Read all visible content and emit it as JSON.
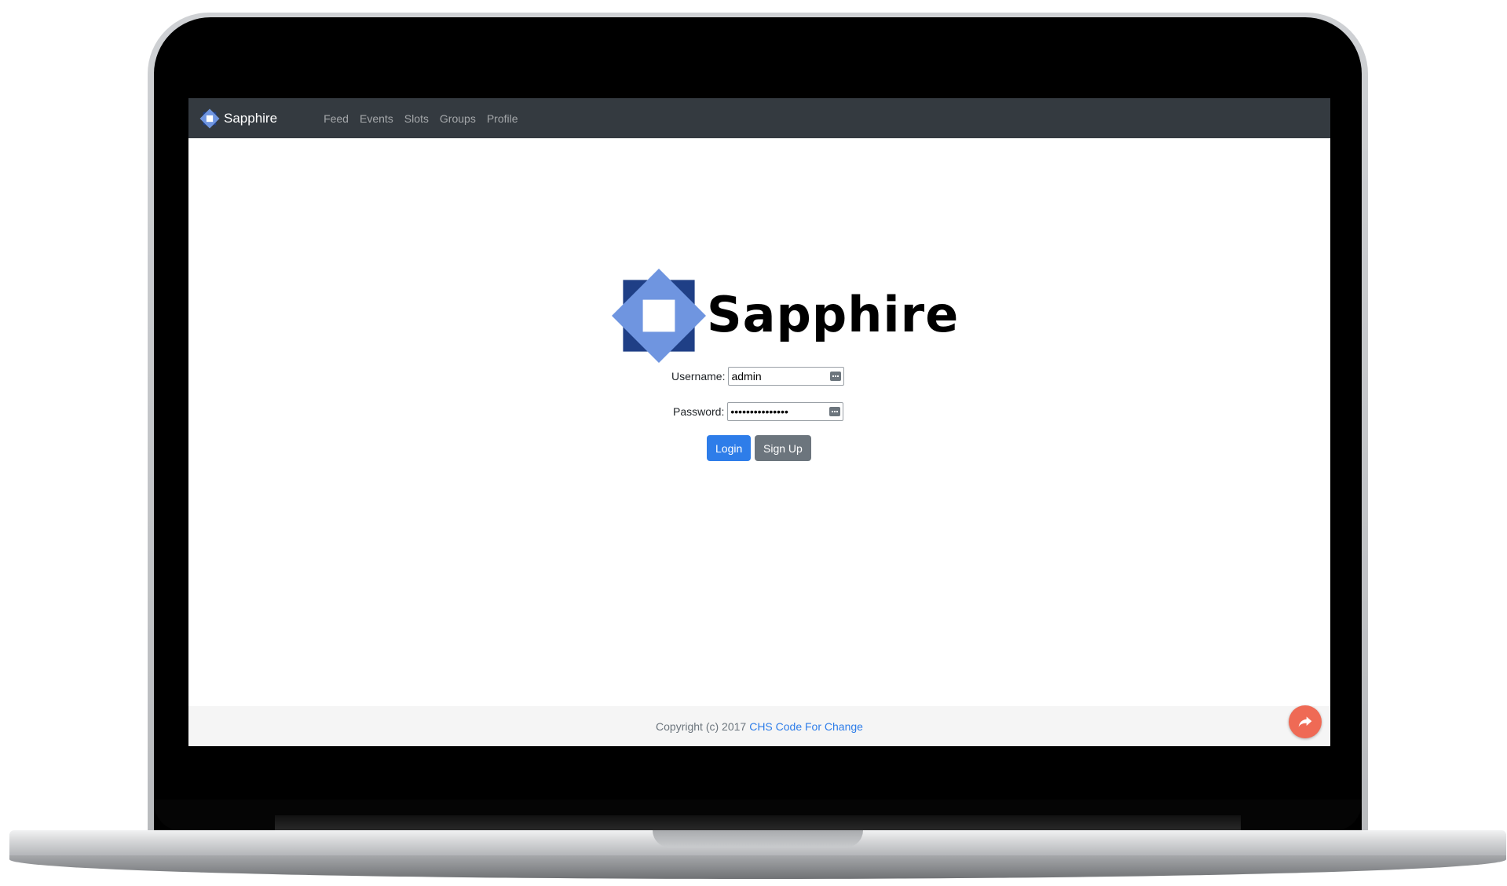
{
  "app": {
    "brand_name": "Sapphire",
    "brand_color": "#6f95e0",
    "brand_dark": "#1f3f86"
  },
  "nav": {
    "items": [
      {
        "label": "Feed"
      },
      {
        "label": "Events"
      },
      {
        "label": "Slots"
      },
      {
        "label": "Groups"
      },
      {
        "label": "Profile"
      }
    ]
  },
  "hero": {
    "wordmark": "Sapphire"
  },
  "login_form": {
    "username_label": "Username:",
    "username_value": "admin",
    "password_label": "Password:",
    "password_value": "•••••••••••••••",
    "login_button": "Login",
    "signup_button": "Sign Up"
  },
  "footer": {
    "copyright_text": "Copyright (c) 2017",
    "link_text": "CHS Code For Change"
  },
  "icons": {
    "brand_logo": "sapphire-logo-icon",
    "key_icon": "password-manager-icon",
    "share_icon": "share-icon"
  },
  "colors": {
    "navbar": "#343a40",
    "primary": "#2e7de9",
    "secondary": "#6c757d",
    "fab": "#ef6a55"
  }
}
